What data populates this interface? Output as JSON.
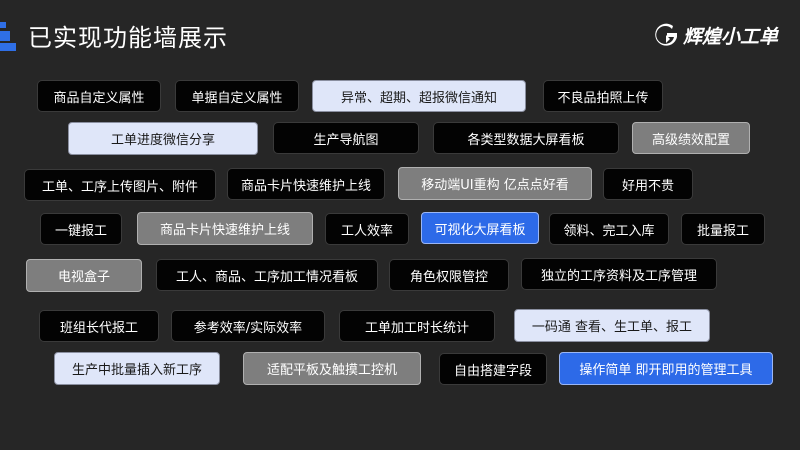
{
  "header": {
    "title": "已实现功能墙展示",
    "logo_text": "辉煌小工单",
    "accent": "#2f6fe6"
  },
  "tags": [
    {
      "label": "商品自定义属性",
      "style": "black"
    },
    {
      "label": "单据自定义属性",
      "style": "black"
    },
    {
      "label": "异常、超期、超报微信通知",
      "style": "light"
    },
    {
      "label": "不良品拍照上传",
      "style": "black"
    },
    {
      "label": "工单进度微信分享",
      "style": "light"
    },
    {
      "label": "生产导航图",
      "style": "black"
    },
    {
      "label": "各类型数据大屏看板",
      "style": "black"
    },
    {
      "label": "高级绩效配置",
      "style": "gray"
    },
    {
      "label": "工单、工序上传图片、附件",
      "style": "black"
    },
    {
      "label": "商品卡片快速维护上线",
      "style": "black"
    },
    {
      "label": "移动端UI重构 亿点点好看",
      "style": "gray"
    },
    {
      "label": "好用不贵",
      "style": "black"
    },
    {
      "label": "一键报工",
      "style": "black"
    },
    {
      "label": "商品卡片快速维护上线",
      "style": "gray"
    },
    {
      "label": "工人效率",
      "style": "black"
    },
    {
      "label": "可视化大屏看板",
      "style": "blue"
    },
    {
      "label": "领料、完工入库",
      "style": "black"
    },
    {
      "label": "批量报工",
      "style": "black"
    },
    {
      "label": "电视盒子",
      "style": "gray"
    },
    {
      "label": "工人、商品、工序加工情况看板",
      "style": "black"
    },
    {
      "label": "角色权限管控",
      "style": "black"
    },
    {
      "label": "独立的工序资料及工序管理",
      "style": "black"
    },
    {
      "label": "班组长代报工",
      "style": "black"
    },
    {
      "label": "参考效率/实际效率",
      "style": "black"
    },
    {
      "label": "工单加工时长统计",
      "style": "black"
    },
    {
      "label": "一码通 查看、生工单、报工",
      "style": "light"
    },
    {
      "label": "生产中批量插入新工序",
      "style": "light"
    },
    {
      "label": "适配平板及触摸工控机",
      "style": "gray"
    },
    {
      "label": "自由搭建字段",
      "style": "black"
    },
    {
      "label": "操作简单 即开即用的管理工具",
      "style": "blue"
    }
  ]
}
